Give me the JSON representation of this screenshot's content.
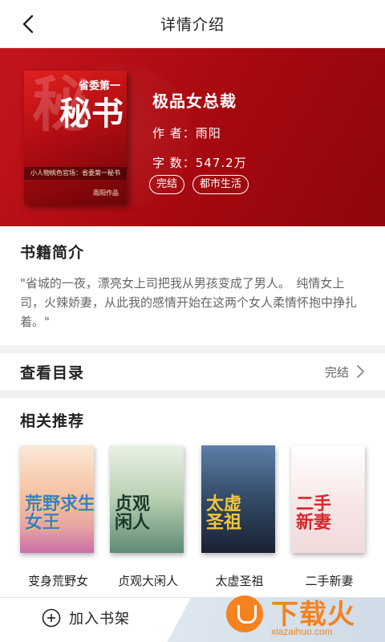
{
  "header": {
    "title": "详情介绍"
  },
  "book": {
    "title": "极品女总裁",
    "author_line": "作 者：雨阳",
    "words_line": "字 数：547.2万",
    "tags": [
      "完结",
      "都市生活"
    ],
    "cover": {
      "big_char": "秘",
      "sub": "省委第一",
      "big": "秘书",
      "strip": "小人物桃色官场：省委第一秘书",
      "author": "雨阳作品"
    }
  },
  "intro": {
    "heading": "书籍简介",
    "text": "\"省城的一夜，漂亮女上司把我从男孩变成了男人。　纯情女上司，火辣娇妻，从此我的感情开始在这两个女人柔情怀抱中挣扎着。\""
  },
  "catalog": {
    "label": "查看目录",
    "status": "完结"
  },
  "recommend": {
    "heading": "相关推荐",
    "items": [
      {
        "name": "变身荒野女",
        "cover_text": "荒野求生\n女王"
      },
      {
        "name": "贞观大闲人",
        "cover_text": "贞观\n闲人"
      },
      {
        "name": "太虚圣祖",
        "cover_text": "太虚\n圣祖"
      },
      {
        "name": "二手新妻",
        "cover_text": "二手\n新妻"
      }
    ]
  },
  "bottom": {
    "add_shelf_label": "加入书架"
  },
  "watermark": {
    "text": "下载火",
    "url": "xiazaihuo.com"
  },
  "colors": {
    "brand_red": "#b80f16",
    "watermark_orange": "#f58220"
  },
  "icons": {
    "back": "chevron-left-icon",
    "chevron": "chevron-right-icon",
    "plus": "plus-circle-icon"
  }
}
